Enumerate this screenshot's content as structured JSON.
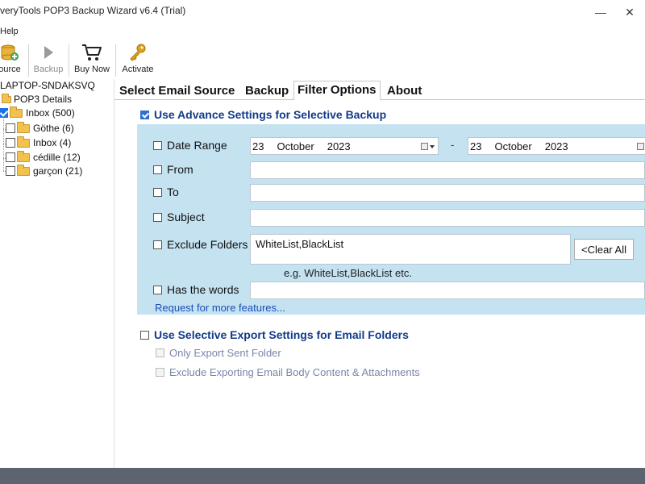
{
  "window": {
    "title": "veryTools POP3 Backup Wizard v6.4 (Trial)",
    "minimize_glyph": "—",
    "close_glyph": "✕"
  },
  "menu": {
    "help_label": "Help"
  },
  "toolbar": {
    "source_label": "ource",
    "backup_label": "Backup",
    "buy_now_label": "Buy Now",
    "activate_label": "Activate",
    "icons": {
      "source": "database-add-icon",
      "backup": "play-icon",
      "buy_now": "shopping-cart-icon",
      "activate": "key-icon"
    }
  },
  "tree": {
    "root_label": "LAPTOP-SNDAKSVQ",
    "account_label": "POP3 Details",
    "items": [
      {
        "label": "Inbox (500)",
        "checked": true
      },
      {
        "label": "Göthe (6)",
        "checked": false
      },
      {
        "label": "Inbox (4)",
        "checked": false
      },
      {
        "label": "cédille (12)",
        "checked": false
      },
      {
        "label": "garçon (21)",
        "checked": false
      }
    ]
  },
  "tabs": [
    {
      "label": "Select Email Source",
      "active": false
    },
    {
      "label": "Backup",
      "active": false
    },
    {
      "label": "Filter Options",
      "active": true
    },
    {
      "label": "About",
      "active": false
    }
  ],
  "filter": {
    "advance_label": "Use Advance Settings for Selective Backup",
    "advance_checked": true,
    "date_range": {
      "label": "Date Range",
      "checked": false,
      "from": {
        "day": "23",
        "month": "October",
        "year": "2023"
      },
      "separator": "-",
      "to": {
        "day": "23",
        "month": "October",
        "year": "2023"
      }
    },
    "from": {
      "label": "From",
      "checked": false,
      "value": ""
    },
    "to": {
      "label": "To",
      "checked": false,
      "value": ""
    },
    "subject": {
      "label": "Subject",
      "checked": false,
      "value": ""
    },
    "exclude_folders": {
      "label": "Exclude Folders",
      "checked": false,
      "value": "WhiteList,BlackList",
      "hint": "e.g. WhiteList,BlackList etc.",
      "clear_label": "<Clear All"
    },
    "has_words": {
      "label": "Has the words",
      "checked": false,
      "value": ""
    },
    "request_link": "Request for more features..."
  },
  "export": {
    "label": "Use Selective Export Settings for Email Folders",
    "checked": false,
    "options": [
      {
        "label": "Only Export Sent Folder",
        "enabled": false
      },
      {
        "label": "Exclude Exporting Email Body Content & Attachments",
        "enabled": false
      }
    ]
  },
  "colors": {
    "panel_bg": "#c5e2f1",
    "heading_blue": "#123a8a",
    "link_blue": "#1a4fb8",
    "status_bar": "#5b6470"
  }
}
